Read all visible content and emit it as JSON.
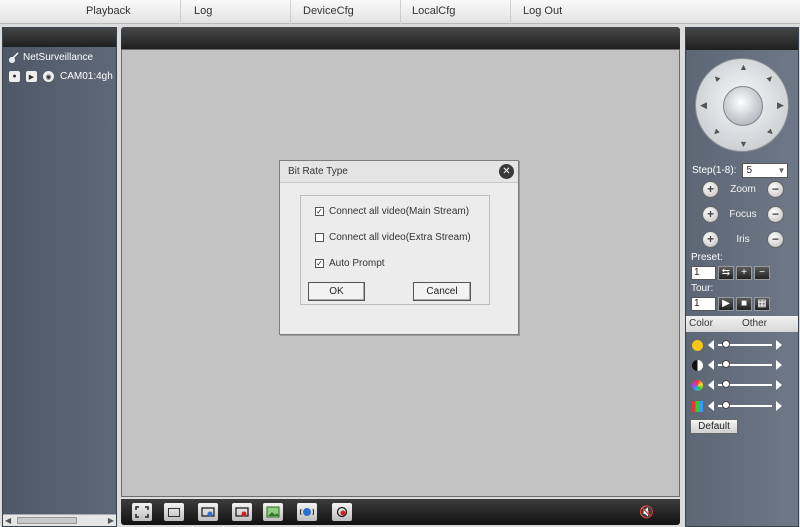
{
  "nav": {
    "items": [
      "Playback",
      "Log",
      "DeviceCfg",
      "LocalCfg",
      "Log Out"
    ]
  },
  "tree": {
    "root": "NetSurveillance",
    "camera": "CAM01:4gh"
  },
  "dialog": {
    "title": "Bit Rate Type",
    "close": "✕",
    "options": [
      {
        "label": "Connect all video(Main Stream)",
        "checked": true,
        "mark": "✓"
      },
      {
        "label": "Connect all video(Extra Stream)",
        "checked": false,
        "mark": ""
      },
      {
        "label": "Auto Prompt",
        "checked": true,
        "mark": "✓"
      }
    ],
    "ok_label": "OK",
    "cancel_label": "Cancel"
  },
  "ptz": {
    "step_label": "Step(1-8):",
    "step_value": "5",
    "zoom_label": "Zoom",
    "focus_label": "Focus",
    "iris_label": "Iris",
    "preset_label": "Preset:",
    "preset_value": "1",
    "tour_label": "Tour:",
    "tour_value": "1"
  },
  "color": {
    "tab_color": "Color",
    "tab_other": "Other",
    "levels": [
      0.08,
      0.08,
      0.08,
      0.08
    ],
    "default_label": "Default"
  },
  "colors": {
    "panel": "#5c6674",
    "header": "#2a2a2a",
    "video_bg": "#c3c3c3",
    "volume_icon": "#f3b34a"
  }
}
